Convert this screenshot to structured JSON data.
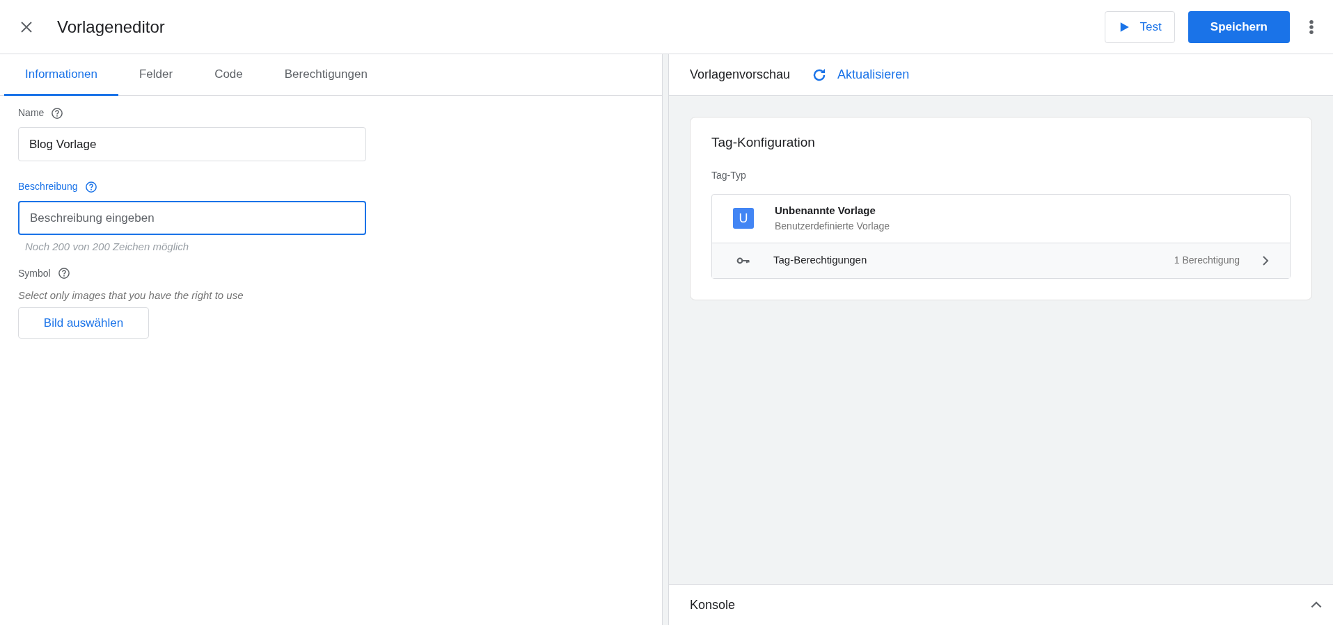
{
  "header": {
    "title": "Vorlageneditor",
    "buttons": [
      {
        "kind": "test",
        "label": "Test"
      },
      {
        "kind": "save",
        "label": "Speichern"
      }
    ]
  },
  "tabs": [
    {
      "label": "Informationen",
      "selected": true
    },
    {
      "label": "Felder",
      "selected": false
    },
    {
      "label": "Code",
      "selected": false
    },
    {
      "label": "Berechtigungen",
      "selected": false
    }
  ],
  "form": {
    "name": {
      "label": "Name",
      "value": "Blog Vorlage",
      "focused": false
    },
    "description": {
      "label": "Beschreibung",
      "placeholder": "Beschreibung eingeben",
      "focused": true,
      "hint": "Noch 200 von 200 Zeichen möglich"
    },
    "symbol": {
      "label": "Symbol",
      "note": "Select only images that you have the right to use",
      "button": "Bild auswählen"
    }
  },
  "preview": {
    "title": "Vorlagenvorschau",
    "refresh": "Aktualisieren",
    "card": {
      "title": "Tag-Konfiguration",
      "section": "Tag-Typ",
      "letter": "U",
      "name": "Unbenannte Vorlage",
      "subtitle": "Benutzerdefinierte Vorlage",
      "permissions": {
        "label": "Tag-Berechtigungen",
        "count": "1 Berechtigung"
      }
    }
  },
  "console": {
    "label": "Konsole",
    "expanded": false
  }
}
